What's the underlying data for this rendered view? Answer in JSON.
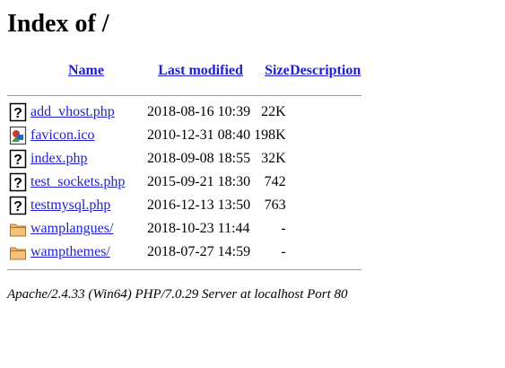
{
  "page": {
    "title": "Index of /",
    "footer": "Apache/2.4.33 (Win64) PHP/7.0.29 Server at localhost Port 80"
  },
  "columns": {
    "name": "Name",
    "last_modified": "Last modified",
    "size": "Size",
    "description": "Description"
  },
  "files": [
    {
      "name": "add_vhost.php",
      "modified": "2018-08-16 10:39",
      "size": "22K",
      "icon": "unknown-file-icon"
    },
    {
      "name": "favicon.ico",
      "modified": "2010-12-31 08:40",
      "size": "198K",
      "icon": "image-file-icon"
    },
    {
      "name": "index.php",
      "modified": "2018-09-08 18:55",
      "size": "32K",
      "icon": "unknown-file-icon"
    },
    {
      "name": "test_sockets.php",
      "modified": "2015-09-21 18:30",
      "size": "742",
      "icon": "unknown-file-icon"
    },
    {
      "name": "testmysql.php",
      "modified": "2016-12-13 13:50",
      "size": "763",
      "icon": "unknown-file-icon"
    },
    {
      "name": "wamplangues/",
      "modified": "2018-10-23 11:44",
      "size": "-",
      "icon": "folder-icon"
    },
    {
      "name": "wampthemes/",
      "modified": "2018-07-27 14:59",
      "size": "-",
      "icon": "folder-icon"
    }
  ]
}
